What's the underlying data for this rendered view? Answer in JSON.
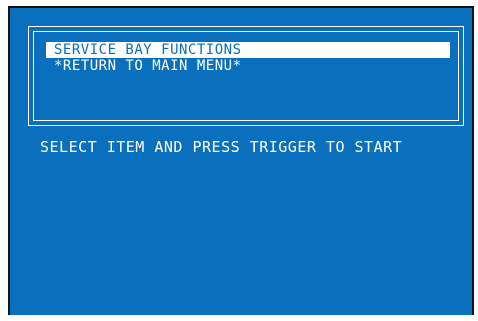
{
  "menu": {
    "items": [
      {
        "label": "SERVICE BAY FUNCTIONS",
        "selected": true
      },
      {
        "label": "*RETURN TO MAIN MENU*",
        "selected": false
      }
    ]
  },
  "instruction": "SELECT ITEM AND PRESS TRIGGER TO START",
  "colors": {
    "background": "#0a6fbd",
    "text": "#ffffff",
    "highlight": "#ffffff"
  }
}
